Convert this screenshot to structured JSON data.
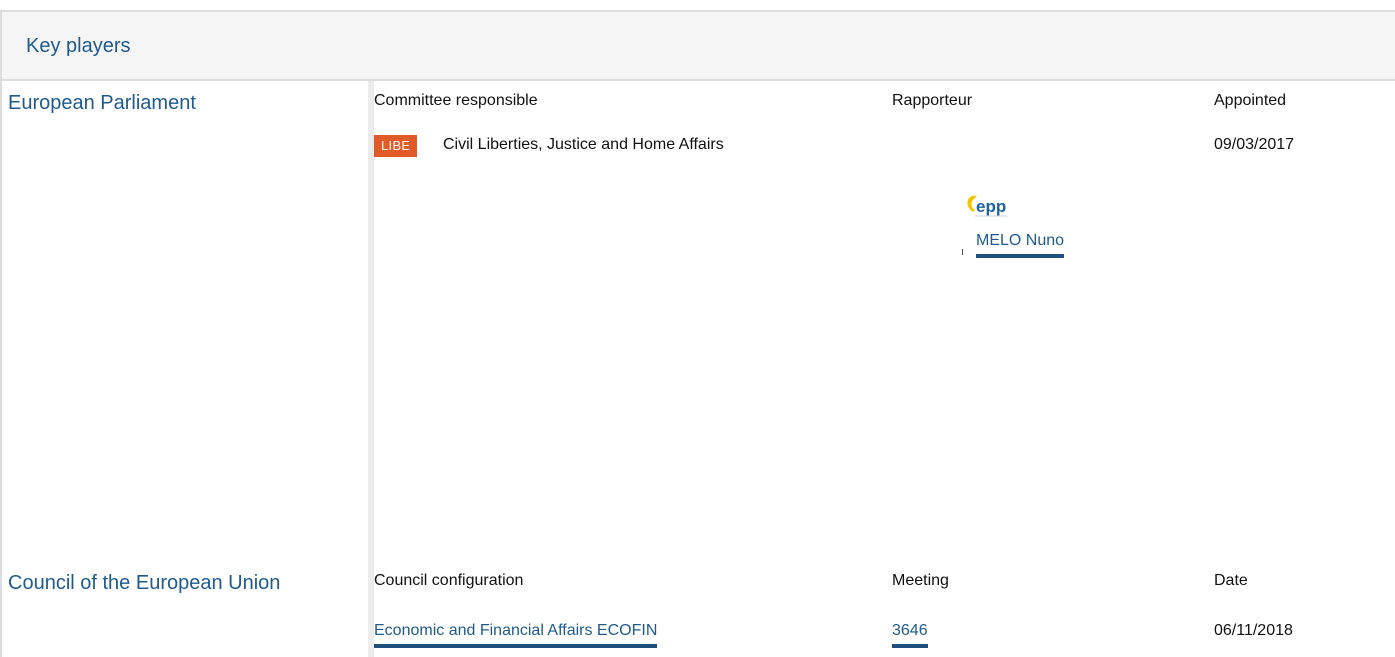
{
  "panel": {
    "title": "Key players"
  },
  "european_parliament": {
    "name": "European Parliament",
    "headers": {
      "committee": "Committee responsible",
      "rapporteur": "Rapporteur",
      "appointed": "Appointed"
    },
    "committee_badge": "LIBE",
    "committee_name": "Civil Liberties, Justice and Home Affairs",
    "appointed_date": "09/03/2017",
    "rapporteur_logo_text": "epp",
    "rapporteur_name": "MELO Nuno",
    "badge_color": "#e35a29"
  },
  "council": {
    "name": "Council of the European Union",
    "headers": {
      "configuration": "Council configuration",
      "meeting": "Meeting",
      "date": "Date"
    },
    "configuration": "Economic and Financial Affairs ECOFIN",
    "meeting": "3646",
    "date": "06/11/2018"
  },
  "colors": {
    "accent": "#1f5a8e",
    "underline": "#1f4f7d"
  }
}
